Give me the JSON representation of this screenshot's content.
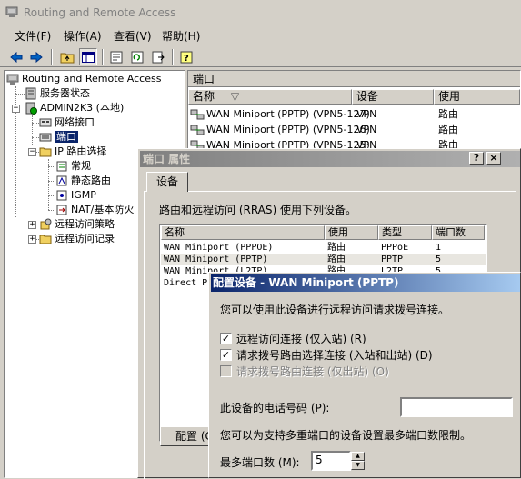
{
  "window": {
    "title": "Routing and Remote Access"
  },
  "menu": [
    {
      "label": "文件(F)",
      "name": "menu-file"
    },
    {
      "label": "操作(A)",
      "name": "menu-action"
    },
    {
      "label": "查看(V)",
      "name": "menu-view"
    },
    {
      "label": "帮助(H)",
      "name": "menu-help"
    }
  ],
  "toolbar": {
    "icons": [
      "back-arrow-icon",
      "forward-arrow-icon",
      "up-folder-icon",
      "show-hide-tree-icon",
      "properties-icon",
      "refresh-icon",
      "export-list-icon",
      "help-icon"
    ]
  },
  "tree": {
    "root": "Routing and Remote Access",
    "server_status": "服务器状态",
    "server": "ADMIN2K3 (本地)",
    "network_interfaces": "网络接口",
    "ports": "端口",
    "ip_routing": "IP 路由选择",
    "general": "常规",
    "static_routes": "静态路由",
    "igmp": "IGMP",
    "nat": "NAT/基本防火",
    "remote_access_policies": "远程访问策略",
    "remote_access_logging": "远程访问记录"
  },
  "right_pane": {
    "header": "端口",
    "columns": [
      "名称",
      "设备",
      "使用"
    ],
    "sort_indicator": "▽",
    "rows": [
      {
        "name": "WAN Miniport (PPTP) (VPN5-127)",
        "device": "VPN",
        "use": "路由"
      },
      {
        "name": "WAN Miniport (PPTP) (VPN5-126)",
        "device": "VPN",
        "use": "路由"
      },
      {
        "name": "WAN Miniport (PPTP) (VPN5-125)",
        "device": "VPN",
        "use": "路由"
      }
    ]
  },
  "port_properties": {
    "title": "端口 属性",
    "help_btn": "?",
    "close_btn": "×",
    "tab": "设备",
    "description": "路由和远程访问 (RRAS) 使用下列设备。",
    "columns": [
      "名称",
      "使用",
      "类型",
      "端口数"
    ],
    "devices": [
      {
        "name": "WAN Miniport (PPPOE)",
        "use": "路由",
        "type": "PPPoE",
        "ports": "1"
      },
      {
        "name": "WAN Miniport (PPTP)",
        "use": "路由",
        "type": "PPTP",
        "ports": "5"
      },
      {
        "name": "WAN Miniport (L2TP)",
        "use": "路由",
        "type": "L2TP",
        "ports": "5"
      },
      {
        "name": "Direct P",
        "use": "",
        "type": "",
        "ports": ""
      }
    ],
    "configure_btn": "配置 (C"
  },
  "configure_device": {
    "title": "配置设备 - WAN Miniport (PPTP)",
    "intro": "您可以使用此设备进行远程访问请求拨号连接。",
    "options": [
      {
        "label": "远程访问连接 (仅入站) (R)",
        "checked": true,
        "enabled": true
      },
      {
        "label": "请求拨号路由选择连接 (入站和出站) (D)",
        "checked": true,
        "enabled": true
      },
      {
        "label": "请求拨号路由连接 (仅出站) (O)",
        "checked": false,
        "enabled": false
      }
    ],
    "phone_label": "此设备的电话号码 (P):",
    "phone_value": "",
    "limit_text": "您可以为支持多重端口的设备设置最多端口数限制。",
    "max_ports_label": "最多端口数 (M):",
    "max_ports_value": "5"
  }
}
